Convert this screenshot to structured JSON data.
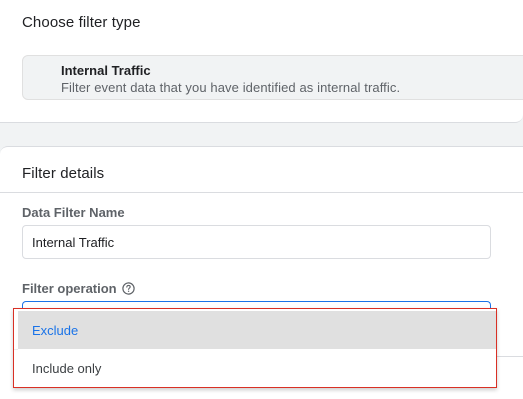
{
  "filter_type_section": {
    "title": "Choose filter type",
    "option": {
      "title": "Internal Traffic",
      "description": "Filter event data that you have identified as internal traffic."
    }
  },
  "filter_details": {
    "title": "Filter details",
    "name_label": "Data Filter Name",
    "name_value": "Internal Traffic",
    "operation_label": "Filter operation",
    "operation_options": [
      {
        "label": "Exclude",
        "selected": true
      },
      {
        "label": "Include only",
        "selected": false
      }
    ]
  },
  "colors": {
    "accent": "#1a73e8",
    "highlight_border": "#d93025",
    "selected_bg": "#e0e0e0",
    "page_bg": "#f1f3f4"
  }
}
